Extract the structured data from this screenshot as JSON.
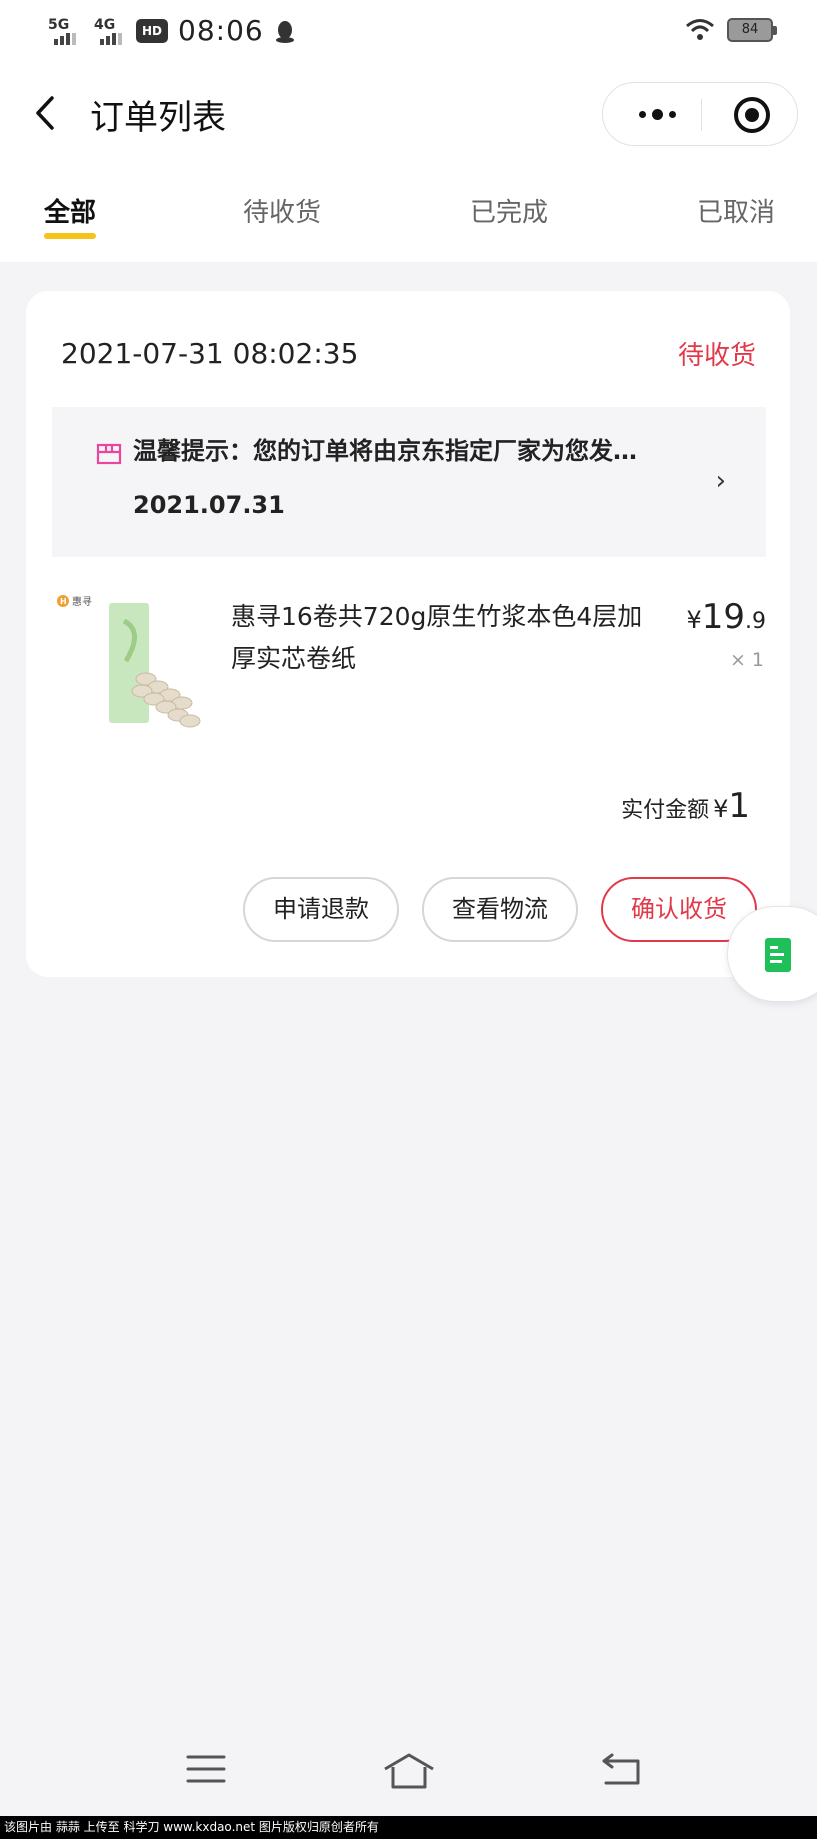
{
  "status_bar": {
    "signal1_label": "5G",
    "signal2_label": "4G",
    "hd_label": "HD",
    "time": "08:06",
    "battery": "84"
  },
  "navbar": {
    "title": "订单列表"
  },
  "tabs": [
    {
      "label": "全部",
      "active": true
    },
    {
      "label": "待收货",
      "active": false
    },
    {
      "label": "已完成",
      "active": false
    },
    {
      "label": "已取消",
      "active": false
    }
  ],
  "order": {
    "datetime": "2021-07-31 08:02:35",
    "status": "待收货",
    "notice_text": "温馨提示：您的订单将由京东指定厂家为您发…",
    "notice_date": "2021.07.31",
    "product": {
      "brand": "惠寻",
      "title": "惠寻16卷共720g原生竹浆本色4层加厚实芯卷纸",
      "price_currency": "¥",
      "price_integer": "19",
      "price_decimal": ".9",
      "quantity": "× 1"
    },
    "paid_label": "实付金额",
    "paid_currency": "¥",
    "paid_amount": "1",
    "buttons": {
      "refund": "申请退款",
      "logistics": "查看物流",
      "confirm": "确认收货"
    }
  },
  "colors": {
    "accent_red": "#e2394a",
    "tab_underline": "#f6c21c",
    "float_icon": "#1fbf5a"
  },
  "watermark": "该图片由 蒜蒜 上传至 科学刀 www.kxdao.net 图片版权归原创者所有"
}
